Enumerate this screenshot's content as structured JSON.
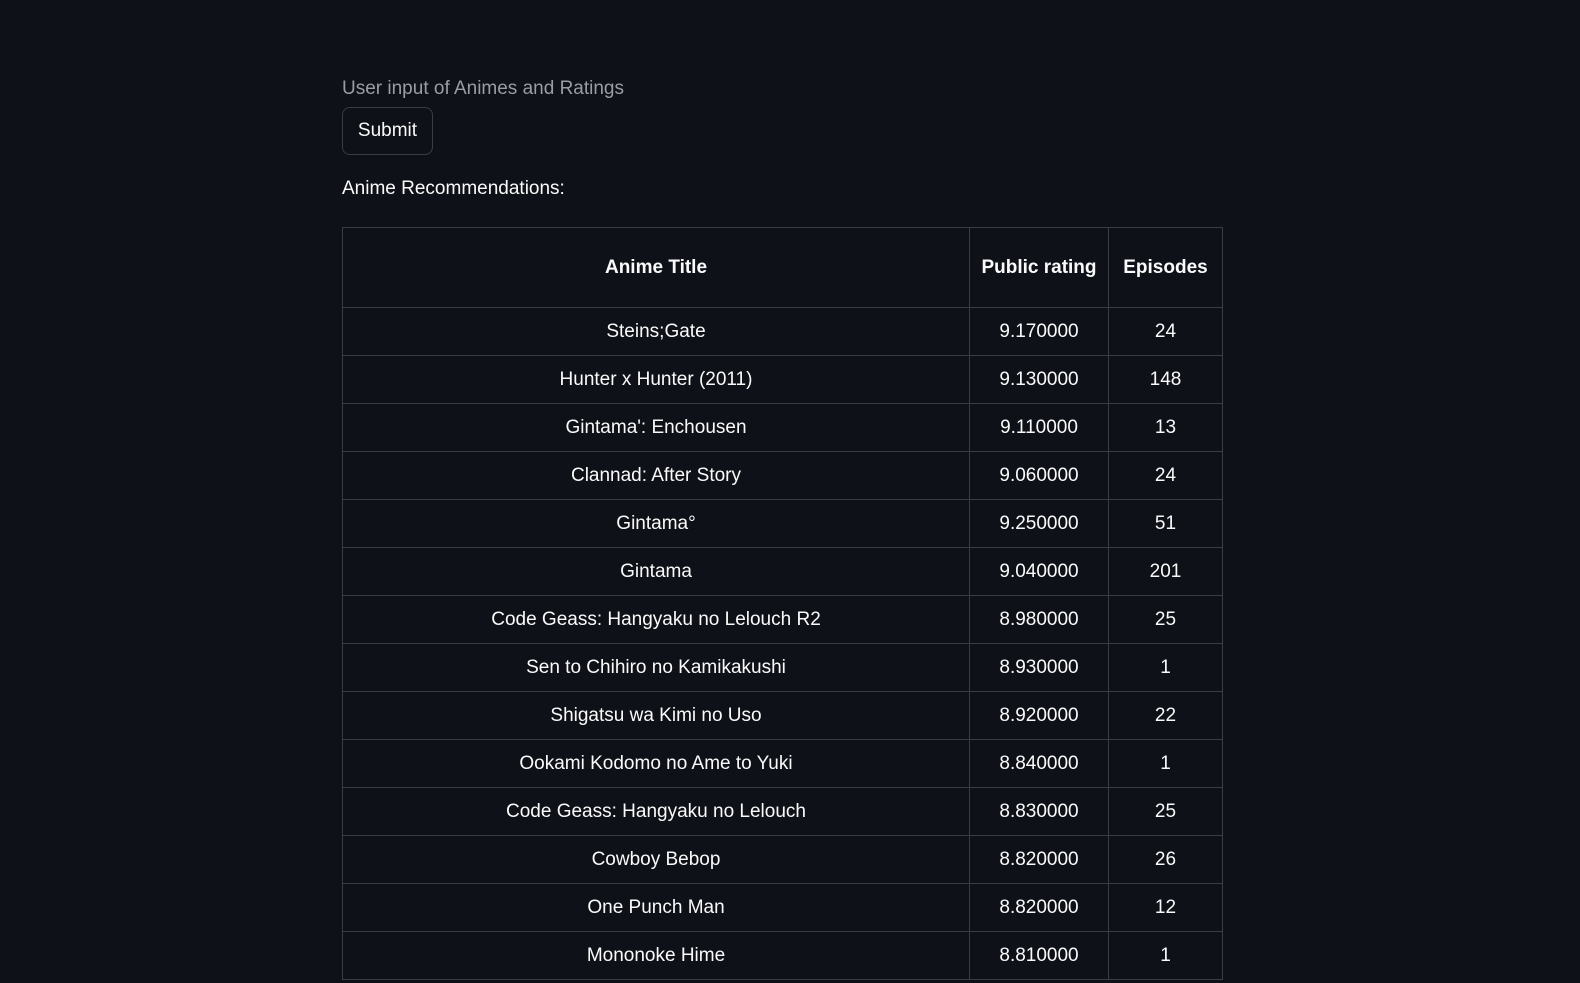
{
  "form": {
    "input_label": "User input of Animes and Ratings",
    "submit_label": "Submit"
  },
  "results": {
    "label": "Anime Recommendations:",
    "columns": [
      "Anime Title",
      "Public rating",
      "Episodes"
    ],
    "rows": [
      [
        "Steins;Gate",
        "9.170000",
        "24"
      ],
      [
        "Hunter x Hunter (2011)",
        "9.130000",
        "148"
      ],
      [
        "Gintama': Enchousen",
        "9.110000",
        "13"
      ],
      [
        "Clannad: After Story",
        "9.060000",
        "24"
      ],
      [
        "Gintama°",
        "9.250000",
        "51"
      ],
      [
        "Gintama",
        "9.040000",
        "201"
      ],
      [
        "Code Geass: Hangyaku no Lelouch R2",
        "8.980000",
        "25"
      ],
      [
        "Sen to Chihiro no Kamikakushi",
        "8.930000",
        "1"
      ],
      [
        "Shigatsu wa Kimi no Uso",
        "8.920000",
        "22"
      ],
      [
        "Ookami Kodomo no Ame to Yuki",
        "8.840000",
        "1"
      ],
      [
        "Code Geass: Hangyaku no Lelouch",
        "8.830000",
        "25"
      ],
      [
        "Cowboy Bebop",
        "8.820000",
        "26"
      ],
      [
        "One Punch Man",
        "8.820000",
        "12"
      ],
      [
        "Mononoke Hime",
        "8.810000",
        "1"
      ]
    ]
  }
}
